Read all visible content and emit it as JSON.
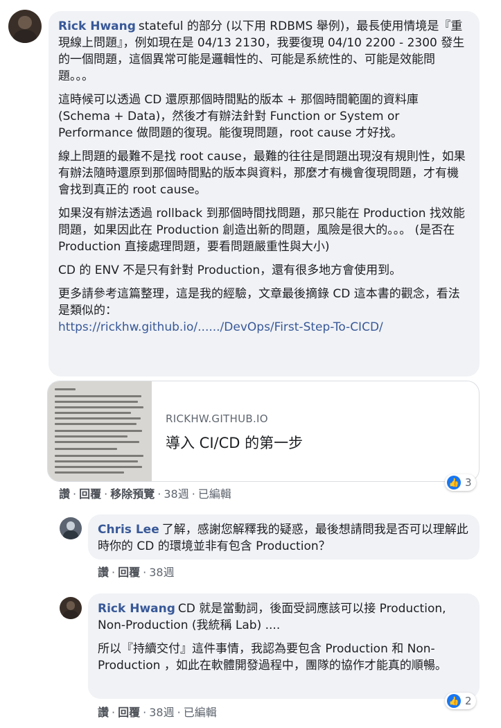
{
  "comments": [
    {
      "author": "Rick Hwang",
      "paragraphs": [
        "stateful 的部分 (以下用 RDBMS 舉例)，最長使用情境是『重現線上問題』，例如現在是 04/13 2130，我要復現 04/10 2200 - 2300 發生的一個問題，這個異常可能是邏輯性的、可能是系統性的、可能是效能問題。。。",
        "這時候可以透過 CD 還原那個時間點的版本 + 那個時間範圍的資料庫 (Schema + Data)，然後才有辦法針對 Function or System or Performance 做問題的復現。能復現問題，root cause 才好找。",
        "線上問題的最難不是找 root cause，最難的往往是問題出現沒有規則性，如果有辦法隨時還原到那個時間點的版本與資料，那麼才有機會復現問題，才有機會找到真正的 root cause。",
        "如果沒有辦法透過 rollback 到那個時間找問題，那只能在 Production 找效能問題，如果因此在 Production 創造出新的問題，風險是很大的。。。 (是否在 Production 直接處理問題，要看問題嚴重性與大小)",
        "CD 的 ENV 不是只有針對 Production，還有很多地方會使用到。",
        "更多請參考這篇整理，這是我的經驗，文章最後摘錄 CD 這本書的觀念，看法是類似的："
      ],
      "link": "https://rickhw.github.io/....../DevOps/First-Step-To-CICD/",
      "preview": {
        "domain": "RICKHW.GITHUB.IO",
        "title": "導入 CI/CD 的第一步"
      },
      "actions": [
        "讚",
        "回覆",
        "移除預覽"
      ],
      "time": "38週",
      "edited": "已編輯",
      "likes": "3"
    },
    {
      "author": "Chris Lee",
      "text": "了解，感謝您解釋我的疑惑，最後想請問我是否可以理解此時你的 CD 的環境並非有包含 Production？",
      "actions": [
        "讚",
        "回覆"
      ],
      "time": "38週"
    },
    {
      "author": "Rick Hwang",
      "text": "CD 就是當動詞，後面受詞應該可以接 Production, Non-Production (我統稱 Lab) ....",
      "text2": "所以『持續交付』這件事情，我認為要包含 Production 和 Non-Production ，如此在軟體開發過程中，團隊的協作才能真的順暢。",
      "actions": [
        "讚",
        "回覆"
      ],
      "time": "38週",
      "edited": "已編輯",
      "likes": "2"
    }
  ],
  "icons": {
    "like": "thumbs-up-icon"
  },
  "colors": {
    "author": "#385898",
    "bubble": "#f0f2f5",
    "like": "#1877f2"
  }
}
